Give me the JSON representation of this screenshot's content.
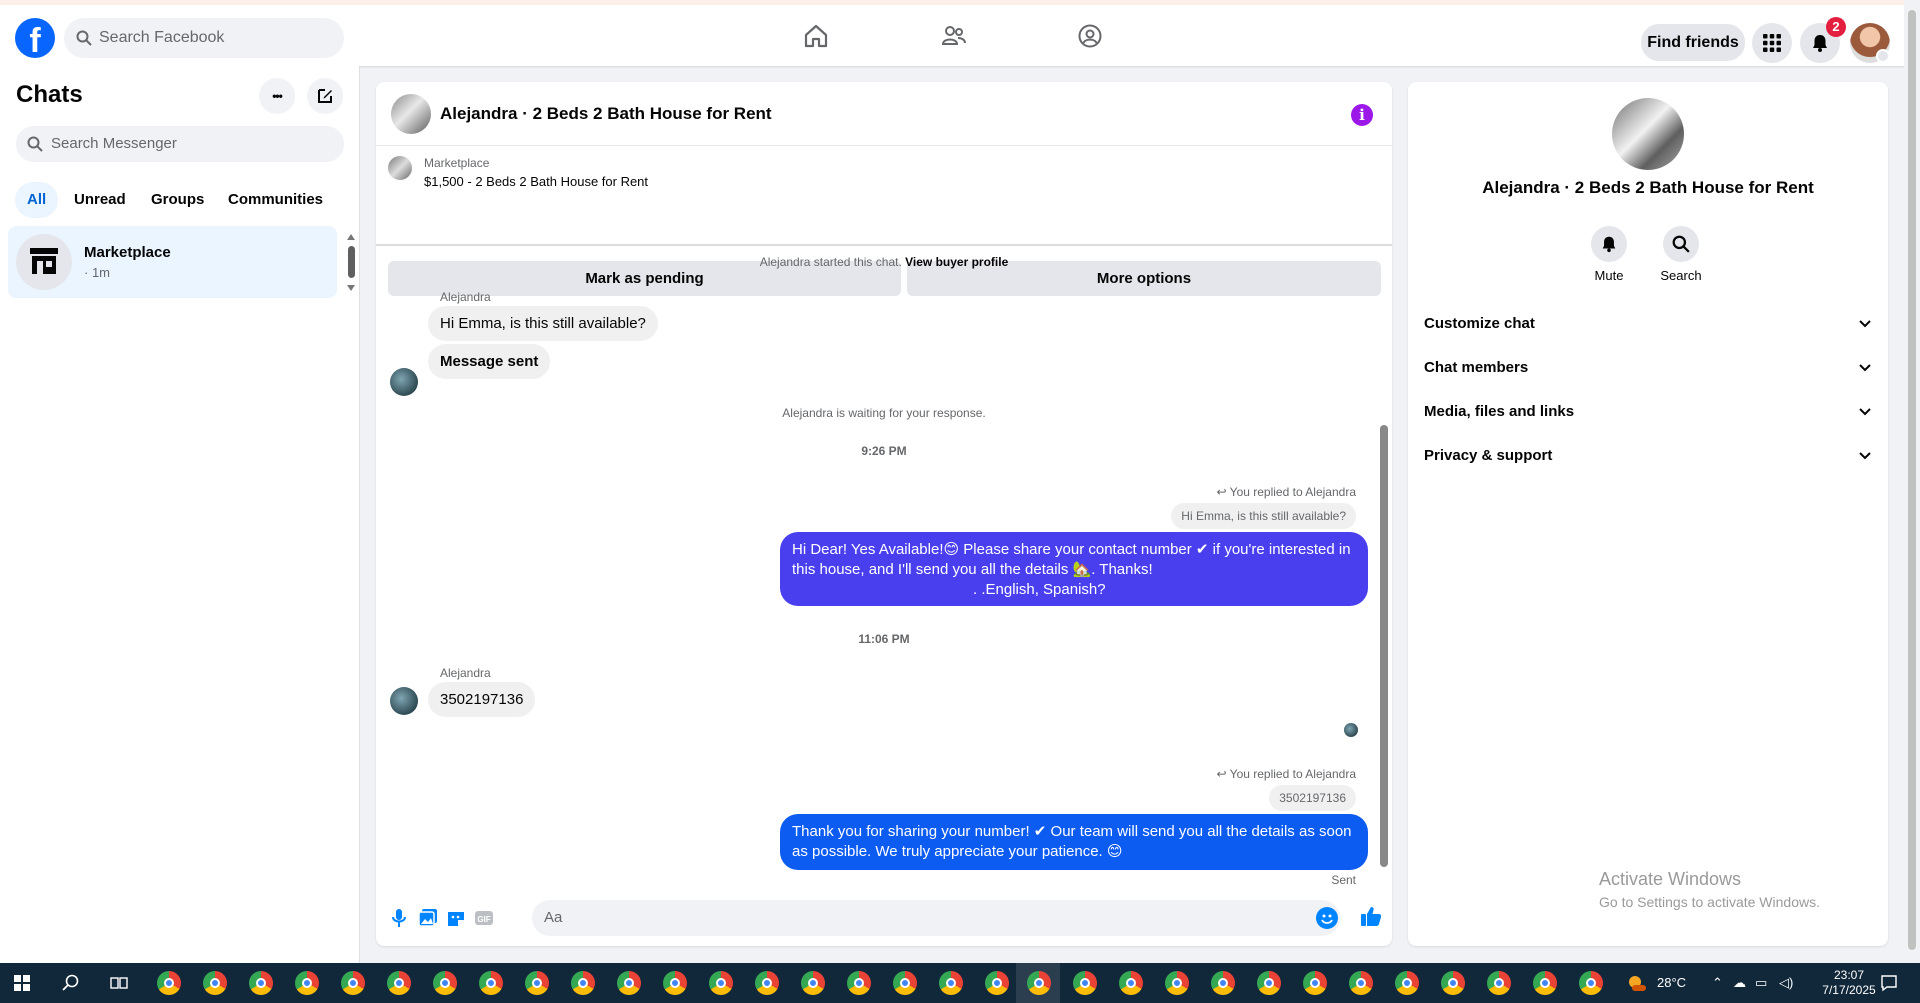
{
  "topbar": {
    "logo": "f",
    "search_placeholder": "Search Facebook",
    "find_friends": "Find friends",
    "notification_count": "2"
  },
  "chats": {
    "title": "Chats",
    "more_label": "•••",
    "search_placeholder": "Search Messenger",
    "filters": [
      "All",
      "Unread",
      "Groups",
      "Communities"
    ],
    "items": [
      {
        "name": "Marketplace",
        "meta": "· 1m"
      }
    ]
  },
  "conversation": {
    "title": "Alejandra · 2 Beds 2 Bath House for Rent",
    "info_glyph": "i",
    "marketplace_label": "Marketplace",
    "listing": "$1,500 - 2 Beds 2 Bath House for Rent",
    "mark_pending": "Mark as pending",
    "more_options": "More options",
    "started": "Alejandra started this chat.",
    "view_buyer": "View buyer profile",
    "sender1": "Alejandra",
    "msg1": "Hi Emma, is this still available?",
    "msg2": "Message sent",
    "waiting": "Alejandra is waiting for your response.",
    "time1": "9:26 PM",
    "reply_note1": "You replied to Alejandra",
    "quoted1": "Hi Emma, is this still available?",
    "out1_line1": "Hi Dear! Yes Available!😊 Please share your contact number ✔ if you're interested in",
    "out1_line2": "this house, and I'll send you all the details 🏡. Thanks!",
    "out1_line3": ".    .English,  Spanish?",
    "out1_color": "#4a3fef",
    "time2": "11:06 PM",
    "sender2": "Alejandra",
    "msg3": "3502197136",
    "reply_note2": "You replied to Alejandra",
    "quoted2": "3502197136",
    "out2_line1": "Thank you for sharing your number! ✔ Our team will send you all the details as soon",
    "out2_line2": "as possible. We truly appreciate your patience. 😊",
    "out2_color": "#0d5cf2",
    "sent": "Sent",
    "composer_placeholder": "Aa"
  },
  "info_panel": {
    "name": "Alejandra · 2 Beds 2 Bath House for Rent",
    "mute": "Mute",
    "search": "Search",
    "sections": [
      "Customize chat",
      "Chat members",
      "Media, files and links",
      "Privacy & support"
    ]
  },
  "watermark": {
    "line1": "Activate Windows",
    "line2": "Go to Settings to activate Windows."
  },
  "taskbar": {
    "temperature": "28°C",
    "time": "23:07",
    "date": "7/17/2025"
  },
  "colors": {
    "facebook_blue": "#0866ff",
    "messenger_blue": "#0084ff",
    "badge_red": "#e41e3f",
    "info_purple": "#9b18e8"
  }
}
